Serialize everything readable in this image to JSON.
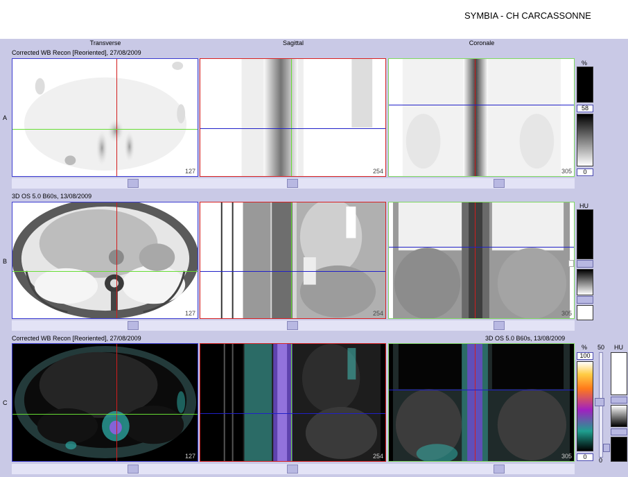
{
  "header": {
    "site": "SYMBIA - CH CARCASSONNE"
  },
  "columns": {
    "transverse": "Transverse",
    "sagittal": "Sagittal",
    "coronal": "Coronale"
  },
  "rows": {
    "a": {
      "letter": "A",
      "series": "Corrected WB Recon [Reoriented], 27/08/2009",
      "slices": [
        "127",
        "254",
        "305"
      ],
      "scale": {
        "unit": "%",
        "value_mid": "58",
        "value_min": "0"
      }
    },
    "b": {
      "letter": "B",
      "series": "3D  OS  5.0  B60s, 13/08/2009",
      "slices": [
        "127",
        "254",
        "305"
      ],
      "scale": {
        "unit": "HU"
      }
    },
    "c": {
      "letter": "C",
      "series_left": "Corrected WB Recon [Reoriented], 27/08/2009",
      "series_right": "3D  OS  5.0  B60s, 13/08/2009",
      "slices": [
        "127",
        "254",
        "305"
      ],
      "scale": {
        "unit": "%",
        "value_max": "100",
        "value_min": "0",
        "mix_top": "50",
        "mix_bottom": "0",
        "unit2": "HU"
      }
    }
  },
  "colors": {
    "background": "#c9c9e6",
    "crosshair_red": "#d31c1c",
    "crosshair_green": "#66dd33",
    "crosshair_blue": "#2020c8"
  }
}
